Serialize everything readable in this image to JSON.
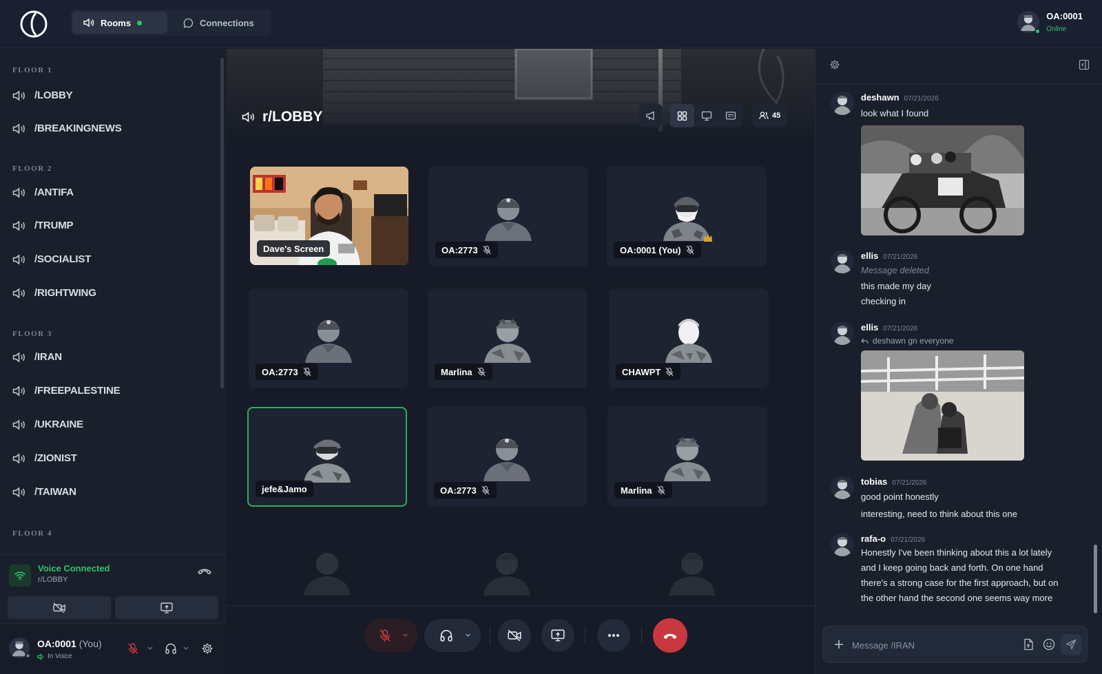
{
  "app": {
    "logo": "logo-icon"
  },
  "nav": {
    "rooms_label": "Rooms",
    "connections_label": "Connections"
  },
  "current_user": {
    "name": "OA:0001",
    "status": "Online"
  },
  "sidebar": {
    "floors": [
      {
        "label": "FLOOR 1",
        "rooms": [
          "/LOBBY",
          "/BREAKINGNEWS"
        ]
      },
      {
        "label": "FLOOR 2",
        "rooms": [
          "/ANTIFA",
          "/TRUMP",
          "/SOCIALIST",
          "/RIGHTWING"
        ]
      },
      {
        "label": "FLOOR 3",
        "rooms": [
          "/IRAN",
          "/FREEPALESTINE",
          "/UKRAINE",
          "/ZIONIST",
          "/TAIWAN"
        ]
      },
      {
        "label": "FLOOR 4",
        "rooms": []
      }
    ]
  },
  "voice": {
    "title": "Voice Connected",
    "room": "r/LOBBY"
  },
  "userbar": {
    "name": "OA:0001",
    "you": "(You)",
    "status": "In Voice"
  },
  "room": {
    "title": "r/LOBBY",
    "participant_count": "45"
  },
  "tiles": [
    {
      "label": "Dave's Screen",
      "type": "screen",
      "muted": false
    },
    {
      "label": "OA:2773",
      "muted": true
    },
    {
      "label": "OA:0001 (You)",
      "muted": true,
      "crown": true
    },
    {
      "label": "OA:2773",
      "muted": true
    },
    {
      "label": "Marlina",
      "muted": true
    },
    {
      "label": "CHAWPT",
      "muted": true
    },
    {
      "label": "jefe&Jamo",
      "muted": false,
      "speaking": true
    },
    {
      "label": "OA:2773",
      "muted": true
    },
    {
      "label": "Marlina",
      "muted": true
    }
  ],
  "chat": {
    "messages": [
      {
        "user": "deshawn",
        "date": "07/21/2026",
        "lines": [
          "look what I found"
        ],
        "image": "old car photo"
      },
      {
        "user": "ellis",
        "date": "07/21/2026",
        "deleted": "Message deleted",
        "lines": [
          "this made my day",
          "checking in"
        ]
      },
      {
        "user": "ellis",
        "date": "07/21/2026",
        "reply": "deshawn  gn everyone",
        "image": "kissing couple photo"
      },
      {
        "user": "tobias",
        "date": "07/21/2026",
        "lines": [
          "good point honestly",
          "interesting, need to think about this one"
        ]
      },
      {
        "user": "rafa-o",
        "date": "07/21/2026",
        "lines": [
          "Honestly I've been thinking about this a lot lately",
          "and I keep going back and forth. On one hand",
          "there's a strong case for the first approach, but on",
          "the other hand the second one seems way more"
        ]
      }
    ],
    "composer_placeholder": "Message /IRAN"
  },
  "colors": {
    "accent_green": "#2fc46a",
    "hangup_red": "#c8383e",
    "background": "#161b27"
  }
}
